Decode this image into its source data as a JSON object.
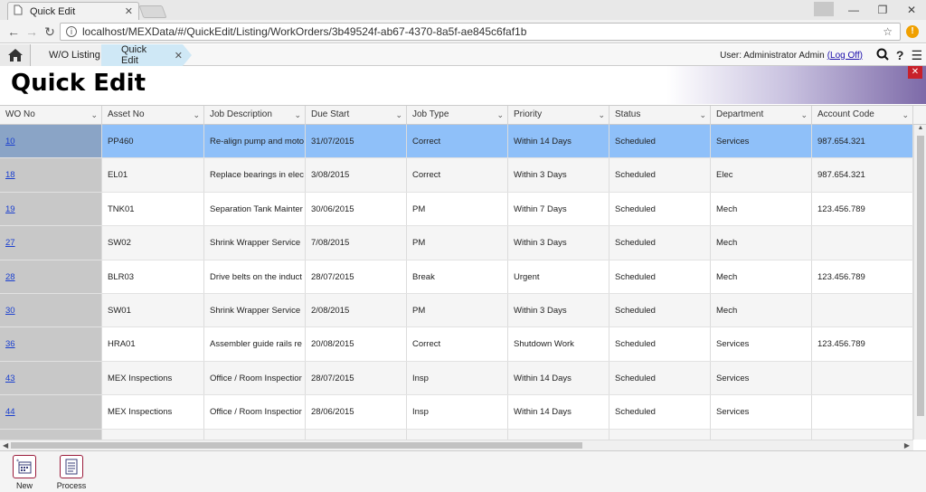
{
  "browser": {
    "tab_title": "Quick Edit",
    "url": "localhost/MEXData/#/QuickEdit/Listing/WorkOrders/3b49524f-ab67-4370-8a5f-ae845c6faf1b"
  },
  "nav": {
    "breadcrumbs": [
      "W/O Listing",
      "Quick Edit"
    ],
    "user_label": "User: Administrator Admin",
    "logoff_label": "(Log Off)"
  },
  "page": {
    "title": "Quick Edit"
  },
  "grid": {
    "columns": [
      "WO No",
      "Asset No",
      "Job Description",
      "Due Start",
      "Job Type",
      "Priority",
      "Status",
      "Department",
      "Account Code"
    ],
    "rows": [
      {
        "wo": "10",
        "asset": "PP460",
        "desc": "Re-align pump and moto",
        "due": "31/07/2015",
        "type": "Correct",
        "priority": "Within 14 Days",
        "status": "Scheduled",
        "dept": "Services",
        "account": "987.654.321"
      },
      {
        "wo": "18",
        "asset": "EL01",
        "desc": "Replace bearings in elec",
        "due": "3/08/2015",
        "type": "Correct",
        "priority": "Within 3 Days",
        "status": "Scheduled",
        "dept": "Elec",
        "account": "987.654.321"
      },
      {
        "wo": "19",
        "asset": "TNK01",
        "desc": "Separation Tank Mainter",
        "due": "30/06/2015",
        "type": "PM",
        "priority": "Within 7 Days",
        "status": "Scheduled",
        "dept": "Mech",
        "account": "123.456.789"
      },
      {
        "wo": "27",
        "asset": "SW02",
        "desc": "Shrink Wrapper Service",
        "due": "7/08/2015",
        "type": "PM",
        "priority": "Within 3 Days",
        "status": "Scheduled",
        "dept": "Mech",
        "account": ""
      },
      {
        "wo": "28",
        "asset": "BLR03",
        "desc": "Drive belts on the induct",
        "due": "28/07/2015",
        "type": "Break",
        "priority": "Urgent",
        "status": "Scheduled",
        "dept": "Mech",
        "account": "123.456.789"
      },
      {
        "wo": "30",
        "asset": "SW01",
        "desc": "Shrink Wrapper Service",
        "due": "2/08/2015",
        "type": "PM",
        "priority": "Within 3 Days",
        "status": "Scheduled",
        "dept": "Mech",
        "account": ""
      },
      {
        "wo": "36",
        "asset": "HRA01",
        "desc": "Assembler guide rails re",
        "due": "20/08/2015",
        "type": "Correct",
        "priority": "Shutdown Work",
        "status": "Scheduled",
        "dept": "Services",
        "account": "123.456.789"
      },
      {
        "wo": "43",
        "asset": "MEX Inspections",
        "desc": "Office / Room Inspectior",
        "due": "28/07/2015",
        "type": "Insp",
        "priority": "Within 14 Days",
        "status": "Scheduled",
        "dept": "Services",
        "account": ""
      },
      {
        "wo": "44",
        "asset": "MEX Inspections",
        "desc": "Office / Room Inspectior",
        "due": "28/06/2015",
        "type": "Insp",
        "priority": "Within 14 Days",
        "status": "Scheduled",
        "dept": "Services",
        "account": ""
      },
      {
        "wo": "",
        "asset": "",
        "desc": "",
        "due": "",
        "type": "",
        "priority": "",
        "status": "",
        "dept": "",
        "account": ""
      }
    ]
  },
  "toolbar": {
    "new_label": "New",
    "process_label": "Process"
  }
}
